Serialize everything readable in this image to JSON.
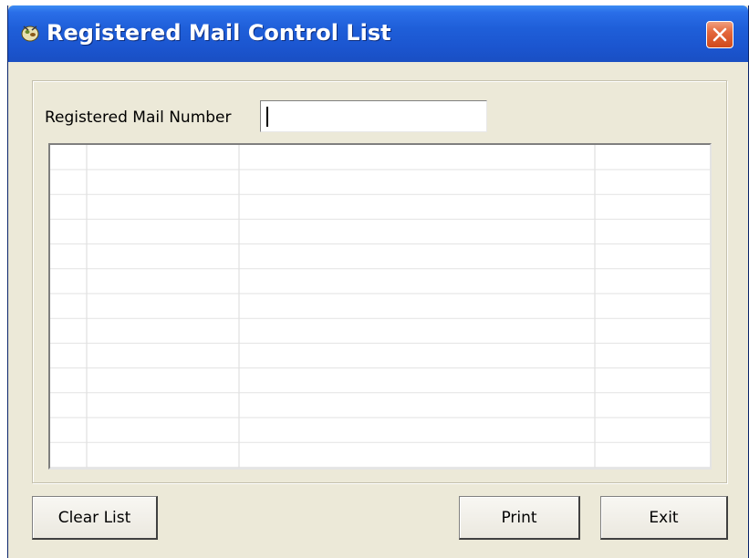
{
  "window": {
    "title": "Registered Mail Control List",
    "icon": "app-icon",
    "close_icon": "close-icon"
  },
  "form": {
    "mail_number_label": "Registered Mail Number",
    "mail_number_value": ""
  },
  "grid": {
    "rows": [],
    "columns": []
  },
  "buttons": {
    "clear_list": "Clear List",
    "print": "Print",
    "exit": "Exit"
  },
  "colors": {
    "titlebar": "#1f5fd9",
    "window_bg": "#ece9d8",
    "close_button": "#e4683c"
  }
}
